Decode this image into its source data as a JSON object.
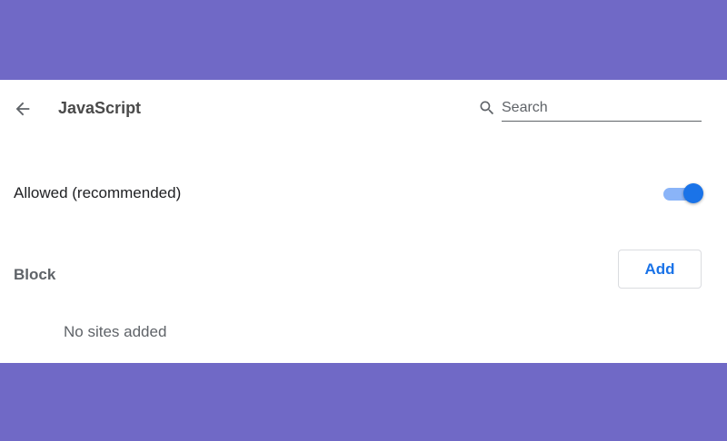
{
  "header": {
    "back_icon": "arrow-left-icon",
    "title": "JavaScript",
    "search_icon": "magnifier-icon",
    "search_placeholder": "Search",
    "search_value": ""
  },
  "settings": {
    "allowed_label": "Allowed (recommended)",
    "allowed_enabled": true,
    "block_label": "Block",
    "add_label": "Add",
    "block_empty_text": "No sites added"
  },
  "colors": {
    "background_band": "#7069c6",
    "panel": "#ffffff",
    "accent": "#1a73e8",
    "toggle_track": "#8ab4f8"
  }
}
